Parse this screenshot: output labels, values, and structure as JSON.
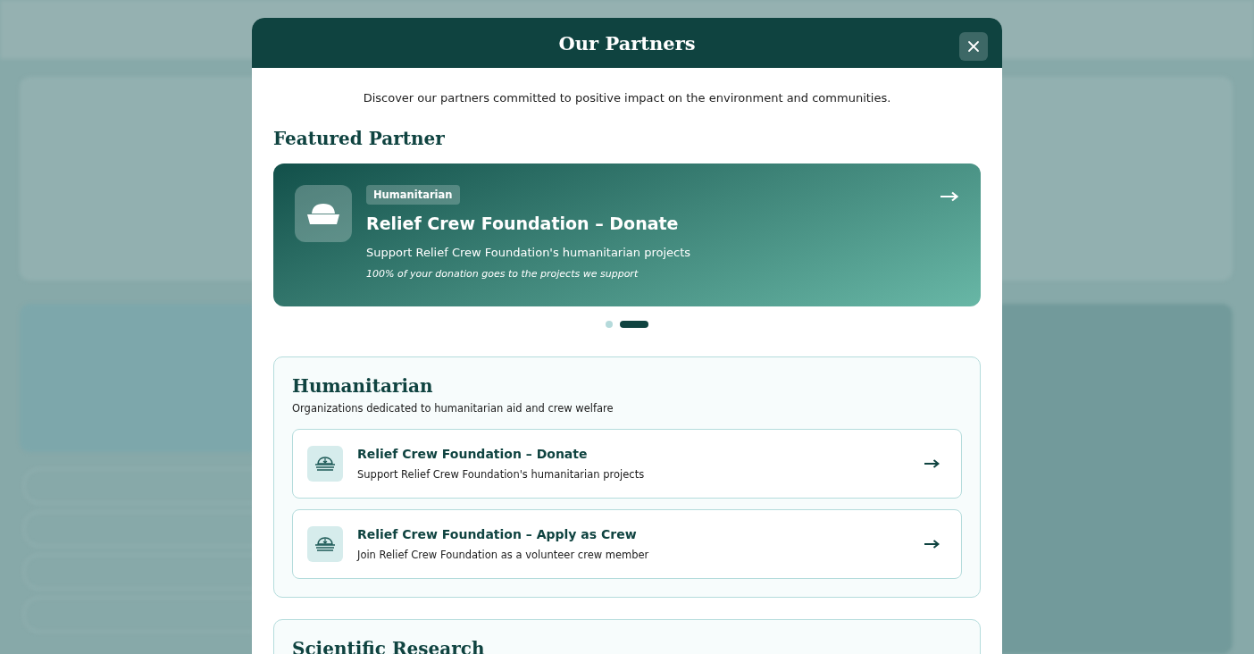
{
  "modal": {
    "title": "Our Partners",
    "intro": "Discover our partners committed to positive impact on the environment and communities.",
    "featured": {
      "heading": "Featured Partner",
      "tag": "Humanitarian",
      "name": "Relief Crew Foundation – Donate",
      "description": "Support Relief Crew Foundation's humanitarian projects",
      "note": "100% of your donation goes to the projects we support"
    },
    "carousel_dots": [
      {
        "selected": false
      },
      {
        "selected": true
      }
    ],
    "sections": [
      {
        "title": "Humanitarian",
        "description": "Organizations dedicated to humanitarian aid and crew welfare",
        "partners": [
          {
            "name": "Relief Crew Foundation – Donate",
            "description": "Support Relief Crew Foundation's humanitarian projects"
          },
          {
            "name": "Relief Crew Foundation – Apply as Crew",
            "description": "Join Relief Crew Foundation as a volunteer crew member"
          }
        ]
      },
      {
        "title": "Scientific Research"
      }
    ]
  }
}
